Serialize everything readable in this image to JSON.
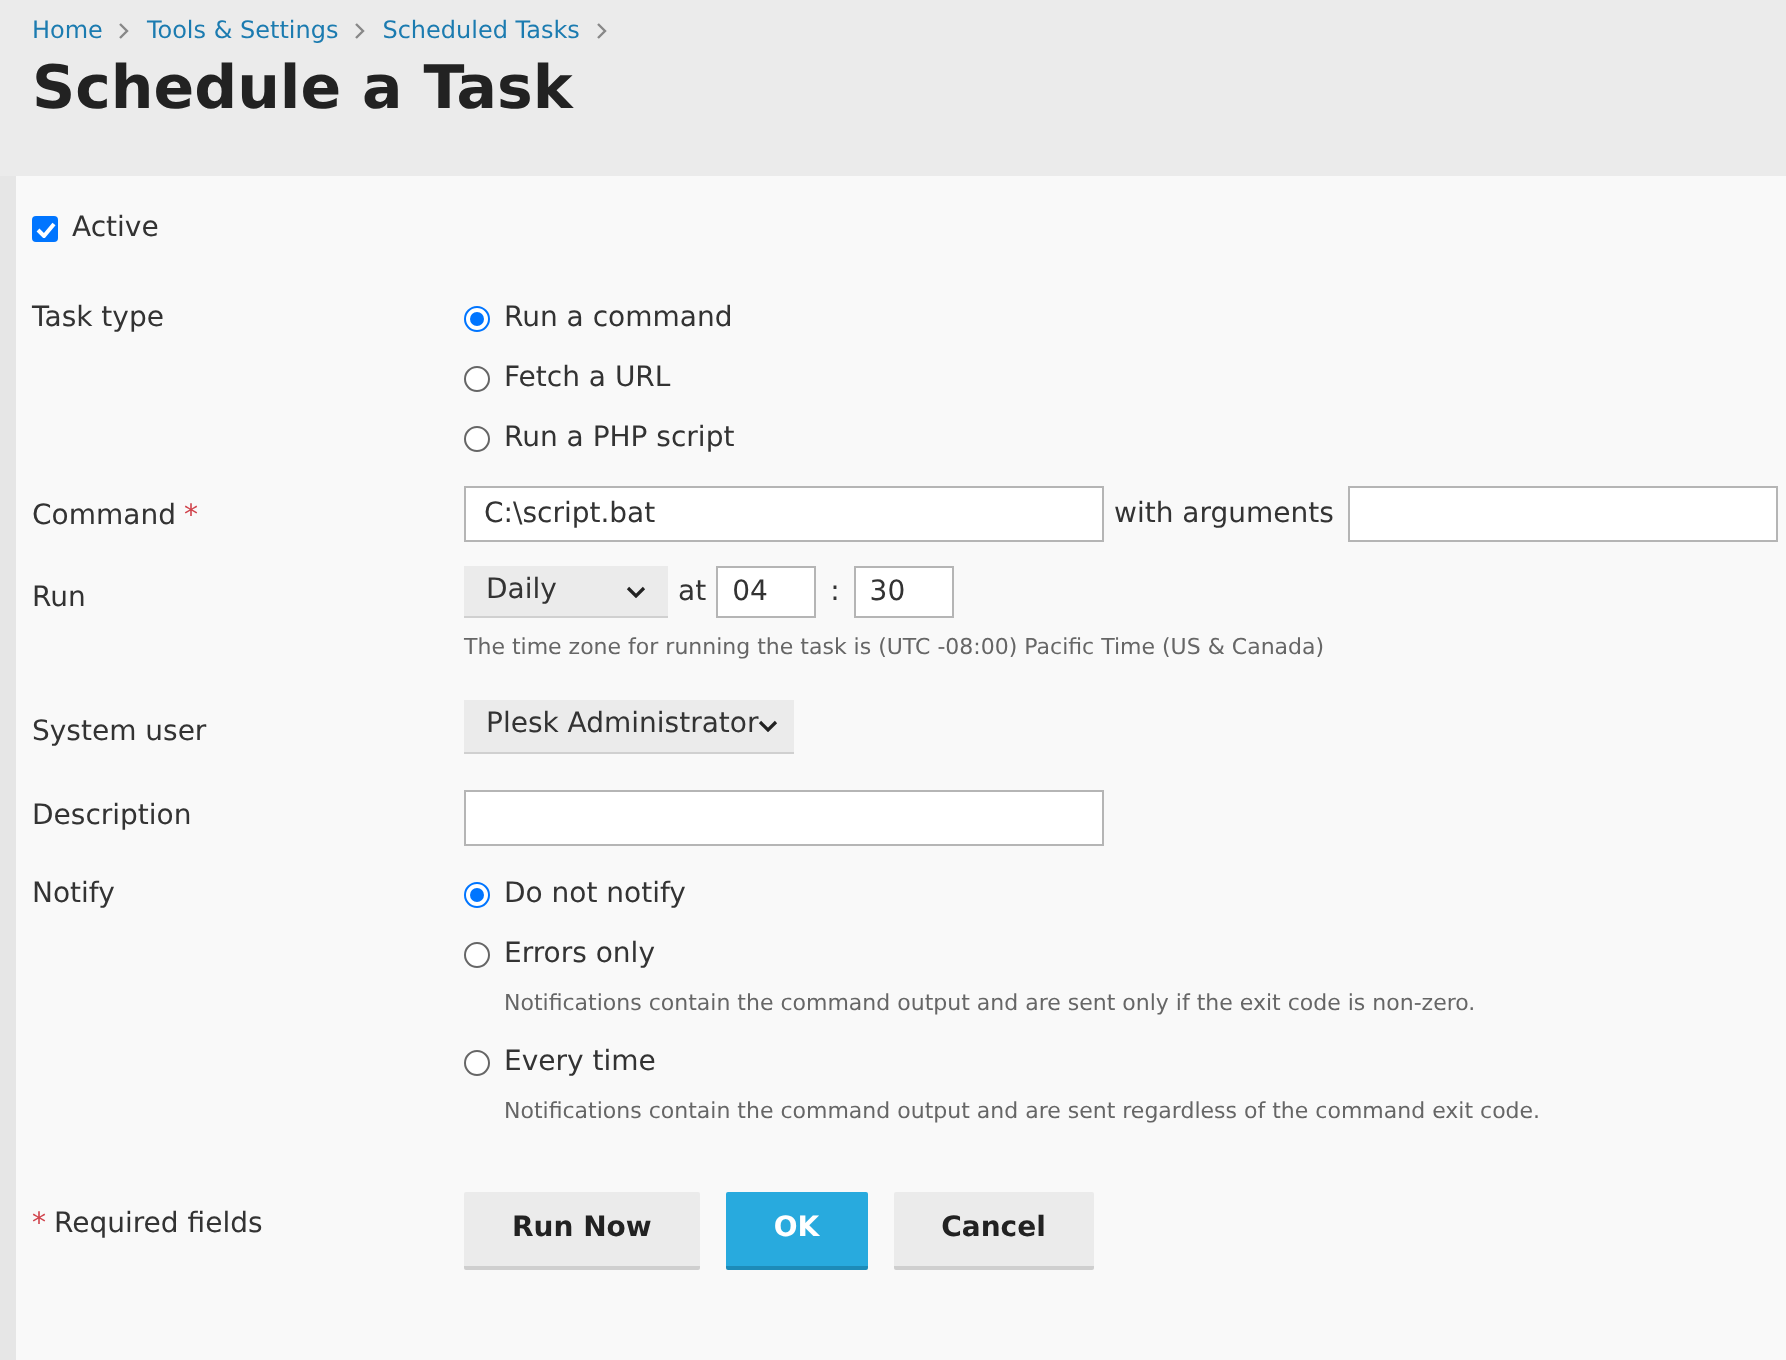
{
  "breadcrumbs": [
    {
      "label": "Home"
    },
    {
      "label": "Tools & Settings"
    },
    {
      "label": "Scheduled Tasks"
    }
  ],
  "title": "Schedule a Task",
  "active": {
    "label": "Active",
    "checked": true
  },
  "task_type": {
    "label": "Task type",
    "options": [
      {
        "label": "Run a command",
        "selected": true
      },
      {
        "label": "Fetch a URL",
        "selected": false
      },
      {
        "label": "Run a PHP script",
        "selected": false
      }
    ]
  },
  "command": {
    "label": "Command",
    "required_mark": "*",
    "value": "C:\\script.bat",
    "arguments_label": "with arguments"
  },
  "run": {
    "label": "Run",
    "frequency": "Daily",
    "at_label": "at",
    "hour": "04",
    "separator": ":",
    "minute": "30",
    "hint": "The time zone for running the task is (UTC -08:00) Pacific Time (US & Canada)"
  },
  "system_user": {
    "label": "System user",
    "value": "Plesk Administrator"
  },
  "description": {
    "label": "Description"
  },
  "notify": {
    "label": "Notify",
    "options": [
      {
        "label": "Do not notify",
        "selected": true
      },
      {
        "label": "Errors only",
        "selected": false,
        "hint": "Notifications contain the command output and are sent only if the exit code is non-zero."
      },
      {
        "label": "Every time",
        "selected": false,
        "hint": "Notifications contain the command output and are sent regardless of the command exit code."
      }
    ]
  },
  "footer": {
    "required_mark": "*",
    "required_label": "Required fields"
  },
  "buttons": [
    {
      "label": "Run Now",
      "kind": "default"
    },
    {
      "label": "OK",
      "kind": "primary"
    },
    {
      "label": "Cancel",
      "kind": "default"
    }
  ]
}
